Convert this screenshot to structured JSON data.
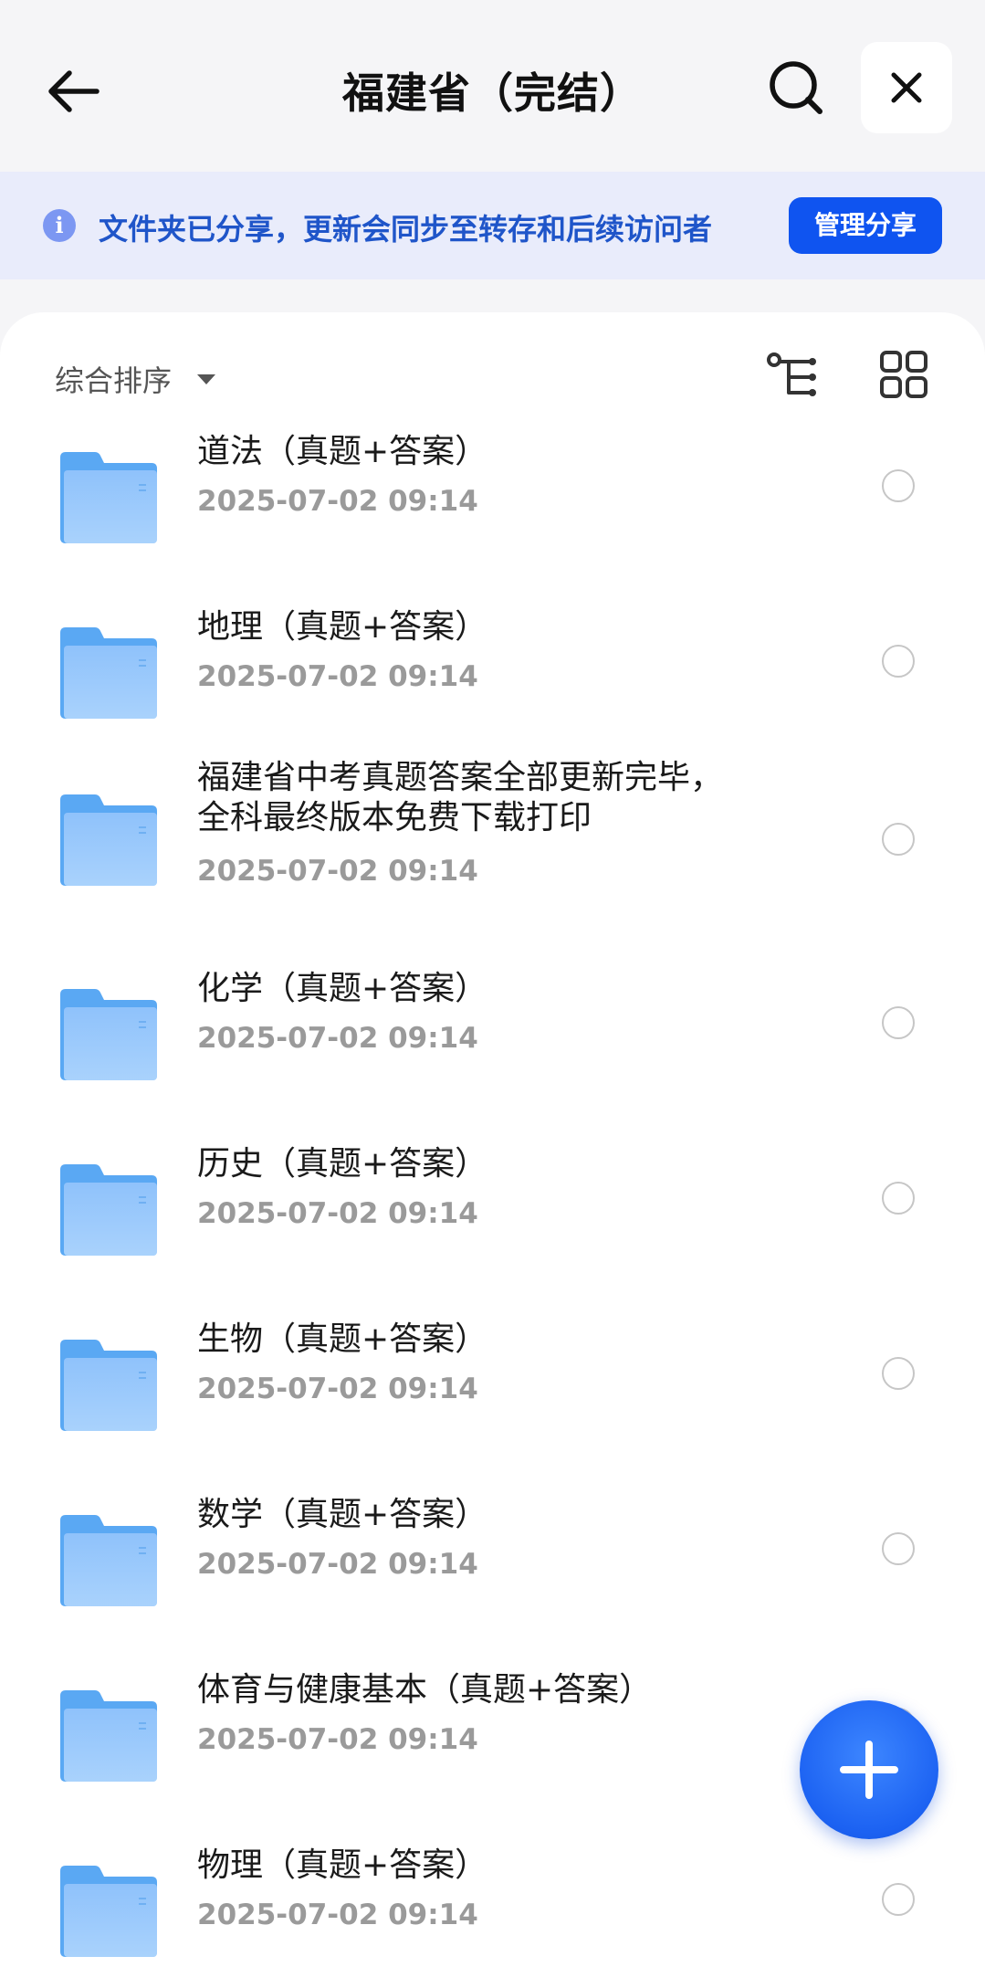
{
  "header": {
    "title": "福建省（完结）",
    "back_icon": "arrow-left-icon",
    "search_icon": "search-icon",
    "close_icon": "close-icon"
  },
  "banner": {
    "icon": "info-icon",
    "info_glyph": "i",
    "text": "文件夹已分享，更新会同步至转存和后续访问者",
    "manage_label": "管理分享",
    "accent": "#0f54f0"
  },
  "toolbar": {
    "sort_label": "综合排序",
    "tree_icon": "tree-view-icon",
    "grid_icon": "grid-view-icon"
  },
  "files": [
    {
      "name": "道法（真题+答案）",
      "date": "2025-07-02 09:14"
    },
    {
      "name": "地理（真题+答案）",
      "date": "2025-07-02 09:14"
    },
    {
      "name": "福建省中考真题答案全部更新完毕，\n全科最终版本免费下载打印",
      "date": "2025-07-02 09:14"
    },
    {
      "name": "化学（真题+答案）",
      "date": "2025-07-02 09:14"
    },
    {
      "name": "历史（真题+答案）",
      "date": "2025-07-02 09:14"
    },
    {
      "name": "生物（真题+答案）",
      "date": "2025-07-02 09:14"
    },
    {
      "name": "数学（真题+答案）",
      "date": "2025-07-02 09:14"
    },
    {
      "name": "体育与健康基本（真题+答案）",
      "date": "2025-07-02 09:14"
    },
    {
      "name": "物理（真题+答案）",
      "date": "2025-07-02 09:14"
    }
  ],
  "fab": {
    "icon": "plus-icon"
  }
}
